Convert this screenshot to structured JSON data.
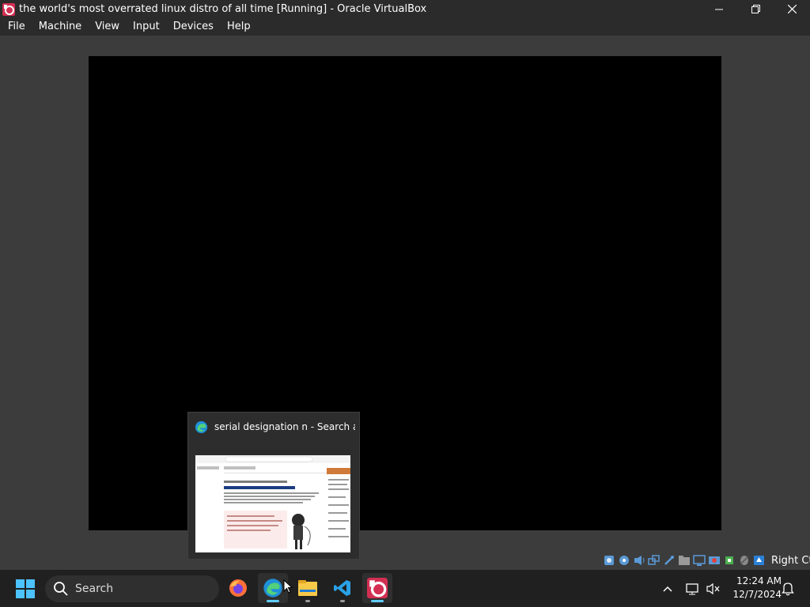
{
  "window": {
    "title": "the world's most overrated linux distro of all time [Running] - Oracle VirtualBox"
  },
  "menu": {
    "items": [
      {
        "label": "File",
        "name": "menu-file"
      },
      {
        "label": "Machine",
        "name": "menu-machine"
      },
      {
        "label": "View",
        "name": "menu-view"
      },
      {
        "label": "Input",
        "name": "menu-input"
      },
      {
        "label": "Devices",
        "name": "menu-devices"
      },
      {
        "label": "Help",
        "name": "menu-help"
      }
    ]
  },
  "preview": {
    "title": "serial designation n - Search an...",
    "app_icon": "edge-icon"
  },
  "statusbar": {
    "host_key": "Right Ctrl",
    "icons": [
      "hard-disk-icon",
      "optical-drive-icon",
      "audio-icon",
      "network-icon",
      "usb-icon",
      "shared-folders-icon",
      "display-icon",
      "recording-icon",
      "cpu-icon",
      "mouse-integration-icon",
      "keyboard-icon"
    ]
  },
  "taskbar": {
    "search_label": "Search",
    "apps": [
      "firefox-icon",
      "edge-icon",
      "file-explorer-icon",
      "vscode-icon",
      "virtualbox-icon"
    ],
    "time": "12:24 AM",
    "date": "12/7/2024"
  },
  "colors": {
    "title_bg": "#2b2b2b",
    "vm_bg": "#3c3c3c",
    "taskbar_bg": "#202020",
    "accent": "#60cdff"
  }
}
